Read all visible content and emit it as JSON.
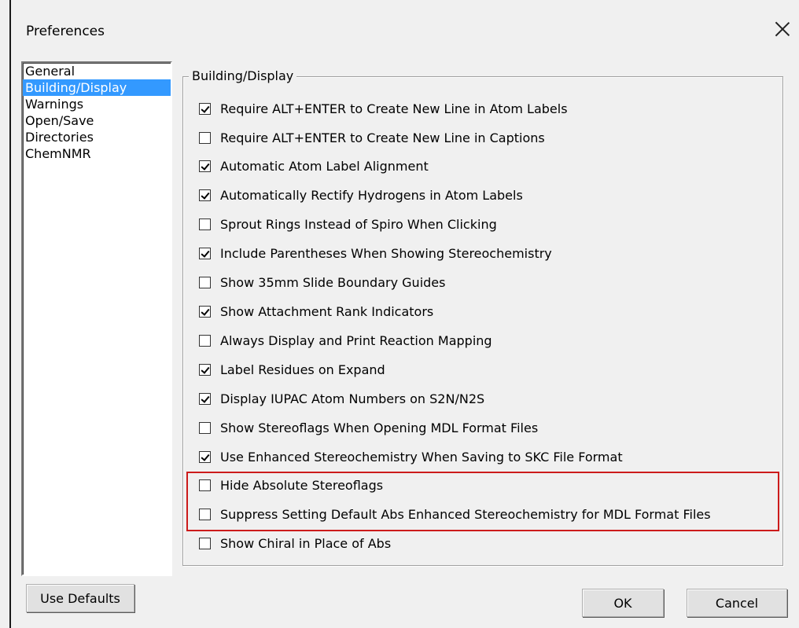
{
  "window": {
    "title": "Preferences"
  },
  "sidebar": {
    "items": [
      {
        "label": "General",
        "selected": false
      },
      {
        "label": "Building/Display",
        "selected": true
      },
      {
        "label": "Warnings",
        "selected": false
      },
      {
        "label": "Open/Save",
        "selected": false
      },
      {
        "label": "Directories",
        "selected": false
      },
      {
        "label": "ChemNMR",
        "selected": false
      }
    ]
  },
  "group": {
    "title": "Building/Display",
    "options": [
      {
        "label": "Require ALT+ENTER to Create New Line in Atom Labels",
        "checked": true
      },
      {
        "label": "Require ALT+ENTER to Create New Line in Captions",
        "checked": false
      },
      {
        "label": "Automatic Atom Label Alignment",
        "checked": true
      },
      {
        "label": "Automatically Rectify Hydrogens in Atom Labels",
        "checked": true
      },
      {
        "label": "Sprout Rings Instead of Spiro When Clicking",
        "checked": false
      },
      {
        "label": "Include Parentheses When Showing Stereochemistry",
        "checked": true
      },
      {
        "label": "Show 35mm Slide Boundary Guides",
        "checked": false
      },
      {
        "label": "Show Attachment Rank Indicators",
        "checked": true
      },
      {
        "label": "Always Display and Print Reaction Mapping",
        "checked": false
      },
      {
        "label": "Label Residues on Expand",
        "checked": true
      },
      {
        "label": "Display IUPAC Atom Numbers on S2N/N2S",
        "checked": true
      },
      {
        "label": "Show Stereoflags When Opening MDL Format Files",
        "checked": false
      },
      {
        "label": "Use Enhanced Stereochemistry When Saving to SKC File Format",
        "checked": true
      },
      {
        "label": "Hide Absolute Stereoflags",
        "checked": false
      },
      {
        "label": "Suppress Setting Default Abs Enhanced Stereochemistry for MDL Format Files",
        "checked": false
      },
      {
        "label": "Show Chiral in Place of Abs",
        "checked": false
      }
    ]
  },
  "highlight_color": "#cc1b1b",
  "selection_color": "#3399ff",
  "buttons": {
    "use_defaults": "Use Defaults",
    "ok": "OK",
    "cancel": "Cancel"
  }
}
